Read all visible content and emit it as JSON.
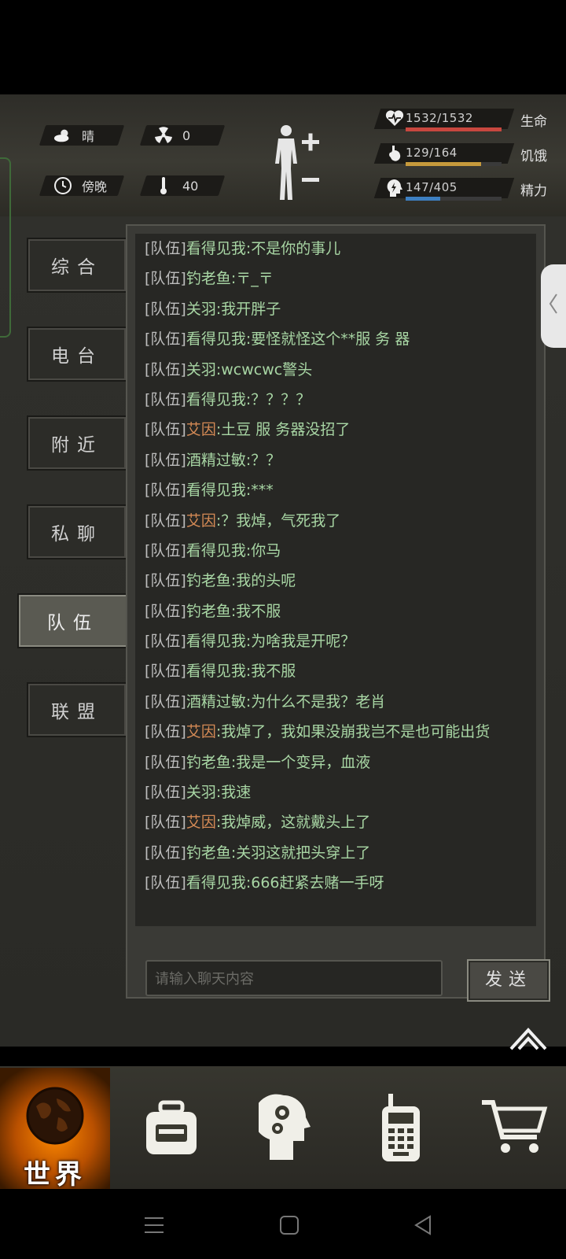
{
  "hud": {
    "weather": "晴",
    "radiation": "0",
    "time_of_day": "傍晚",
    "temperature": "40",
    "stats": [
      {
        "icon": "heart-pulse-icon",
        "value": "1532/1532",
        "label": "生命",
        "fraction": 1.0,
        "color": "#c8473f"
      },
      {
        "icon": "stomach-icon",
        "value": "129/164",
        "label": "饥饿",
        "fraction": 0.787,
        "color": "#c79a3c"
      },
      {
        "icon": "head-energy-icon",
        "value": "147/405",
        "label": "精力",
        "fraction": 0.363,
        "color": "#3d7fc1"
      }
    ]
  },
  "tabs": [
    {
      "label": "综合",
      "active": false
    },
    {
      "label": "电台",
      "active": false
    },
    {
      "label": "附近",
      "active": false
    },
    {
      "label": "私聊",
      "active": false
    },
    {
      "label": "队伍",
      "active": true
    },
    {
      "label": "联盟",
      "active": false
    }
  ],
  "chat": {
    "messages": [
      {
        "tag": "[队伍]",
        "sender": "看得见我",
        "text": "不是你的事儿",
        "highlight": false
      },
      {
        "tag": "[队伍]",
        "sender": "钓老鱼",
        "text": "〒_〒",
        "highlight": false
      },
      {
        "tag": "[队伍]",
        "sender": "关羽",
        "text": "我开胖子",
        "highlight": false
      },
      {
        "tag": "[队伍]",
        "sender": "看得见我",
        "text": "要怪就怪这个**服 务 器",
        "highlight": false
      },
      {
        "tag": "[队伍]",
        "sender": "关羽",
        "text": "wcwcwc警头",
        "highlight": false
      },
      {
        "tag": "[队伍]",
        "sender": "看得见我",
        "text": "？？？？",
        "highlight": false
      },
      {
        "tag": "[队伍]",
        "sender": "艾因",
        "text": "土豆 服 务器没招了",
        "highlight": true
      },
      {
        "tag": "[队伍]",
        "sender": "酒精过敏",
        "text": "？？",
        "highlight": false
      },
      {
        "tag": "[队伍]",
        "sender": "看得见我",
        "text": "***",
        "highlight": false
      },
      {
        "tag": "[队伍]",
        "sender": "艾因",
        "text": "？我焯，气死我了",
        "highlight": true
      },
      {
        "tag": "[队伍]",
        "sender": "看得见我",
        "text": "你马",
        "highlight": false
      },
      {
        "tag": "[队伍]",
        "sender": "钓老鱼",
        "text": "我的头呢",
        "highlight": false
      },
      {
        "tag": "[队伍]",
        "sender": "钓老鱼",
        "text": "我不服",
        "highlight": false
      },
      {
        "tag": "[队伍]",
        "sender": "看得见我",
        "text": "为啥我是开呢？",
        "highlight": false
      },
      {
        "tag": "[队伍]",
        "sender": "看得见我",
        "text": "我不服",
        "highlight": false
      },
      {
        "tag": "[队伍]",
        "sender": "酒精过敏",
        "text": "为什么不是我？老肖",
        "highlight": false
      },
      {
        "tag": "[队伍]",
        "sender": "艾因",
        "text": "我焯了，我如果没崩我岂不是也可能出货",
        "highlight": true
      },
      {
        "tag": "[队伍]",
        "sender": "钓老鱼",
        "text": "我是一个变异，血液",
        "highlight": false
      },
      {
        "tag": "[队伍]",
        "sender": "关羽",
        "text": "我速",
        "highlight": false
      },
      {
        "tag": "[队伍]",
        "sender": "艾因",
        "text": "我焯威，这就戴头上了",
        "highlight": true
      },
      {
        "tag": "[队伍]",
        "sender": "钓老鱼",
        "text": "关羽这就把头穿上了",
        "highlight": false
      },
      {
        "tag": "[队伍]",
        "sender": "看得见我",
        "text": "666赶紧去赌一手呀",
        "highlight": false
      }
    ],
    "input_placeholder": "请输入聊天内容",
    "send_label": "发送"
  },
  "bottom_nav": {
    "world_label": "世界",
    "items": [
      "globe-icon",
      "backpack-icon",
      "skills-head-icon",
      "radio-icon",
      "cart-icon"
    ]
  }
}
